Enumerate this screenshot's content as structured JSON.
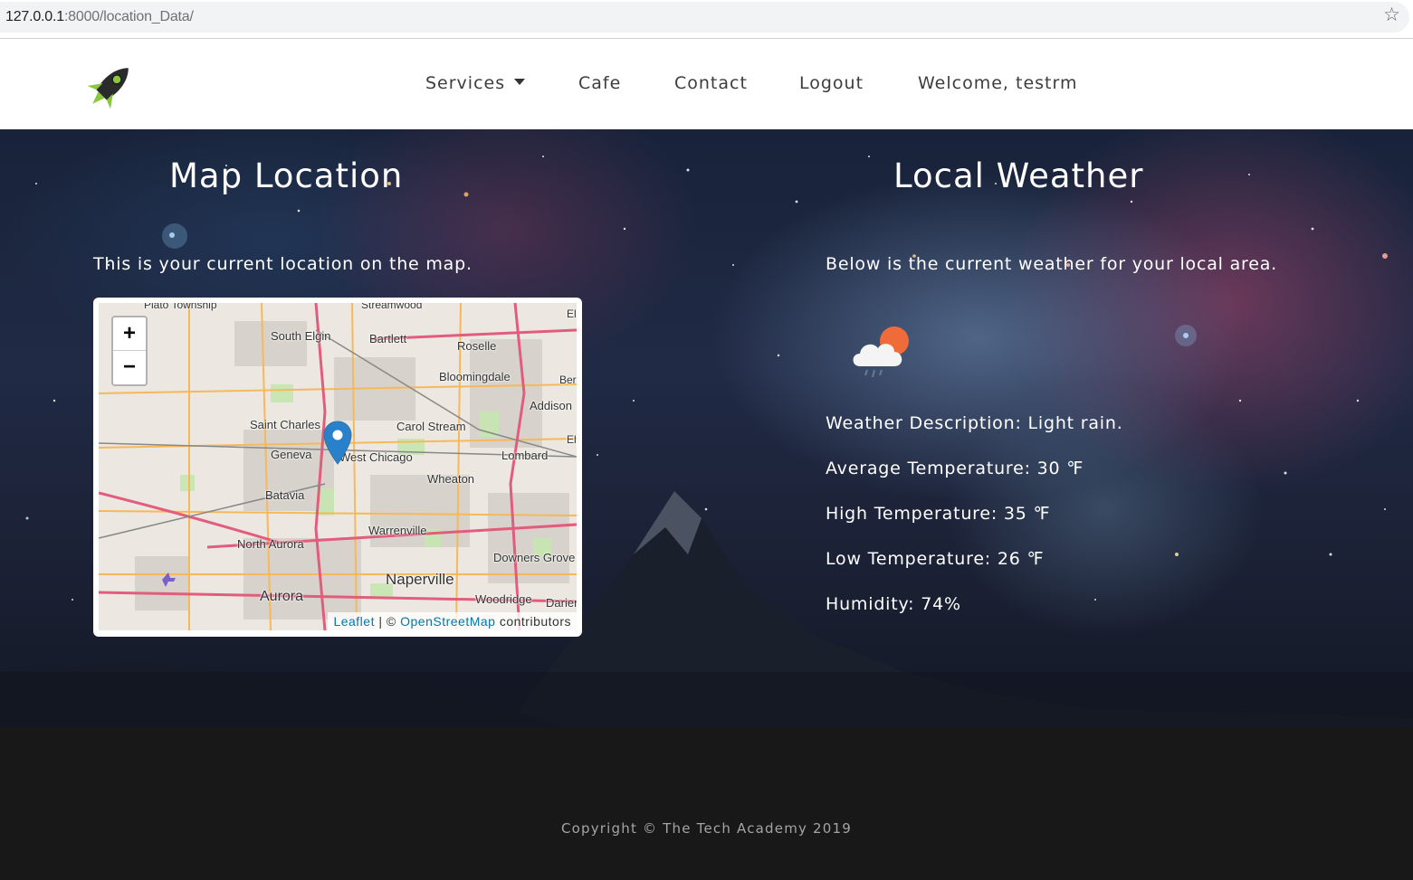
{
  "browser": {
    "url_host": "127.0.0.1",
    "url_rest": ":8000/location_Data/"
  },
  "nav": {
    "items": [
      {
        "label": "Services",
        "has_dropdown": true
      },
      {
        "label": "Cafe"
      },
      {
        "label": "Contact"
      },
      {
        "label": "Logout"
      },
      {
        "label": "Welcome, testrm"
      }
    ]
  },
  "map_section": {
    "title": "Map Location",
    "subtitle": "This is your current location on the map.",
    "zoom_in": "+",
    "zoom_out": "−",
    "attribution": {
      "leaflet": "Leaflet",
      "separator": " | © ",
      "osm": "OpenStreetMap",
      "suffix": " contributors"
    },
    "places": [
      "Plato Township",
      "Streamwood",
      "South Elgin",
      "Bartlett",
      "Roselle",
      "Bloomingdale",
      "Addison",
      "Saint Charles",
      "Carol Stream",
      "Geneva",
      "West Chicago",
      "Lombard",
      "Wheaton",
      "Batavia",
      "Warrenville",
      "North Aurora",
      "Downers Grove",
      "Naperville",
      "Aurora",
      "Woodridge",
      "Darien",
      "Ber",
      "El",
      "El"
    ]
  },
  "weather_section": {
    "title": "Local Weather",
    "subtitle": "Below is the current weather for your local area.",
    "icon": "rain-cloud-sun-icon",
    "description": "Weather Description: Light rain.",
    "average": "Average Temperature: 30 ℉",
    "high": "High Temperature: 35 ℉",
    "low": "Low Temperature: 26 ℉",
    "humidity": "Humidity: 74%"
  },
  "footer": {
    "copyright": "Copyright © The Tech Academy 2019"
  },
  "colors": {
    "navbar_bg": "#ffffff",
    "footer_bg": "#181818",
    "marker": "#2a81cb",
    "map_link": "#0078a8"
  }
}
